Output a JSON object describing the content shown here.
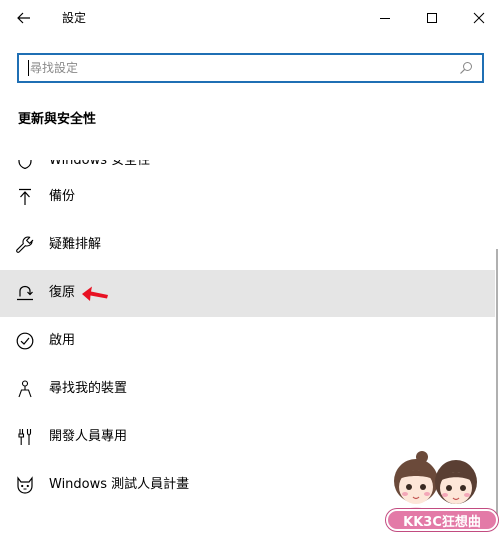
{
  "window": {
    "title": "設定"
  },
  "search": {
    "placeholder": "尋找設定"
  },
  "section": {
    "header": "更新與安全性"
  },
  "nav": {
    "items": [
      {
        "label": "Windows 安全性",
        "icon": "shield-icon"
      },
      {
        "label": "備份",
        "icon": "backup-arrow-icon"
      },
      {
        "label": "疑難排解",
        "icon": "wrench-icon"
      },
      {
        "label": "復原",
        "icon": "recovery-icon",
        "selected": true
      },
      {
        "label": "啟用",
        "icon": "checkmark-circle-icon"
      },
      {
        "label": "尋找我的裝置",
        "icon": "person-pin-icon"
      },
      {
        "label": "開發人員專用",
        "icon": "developer-tools-icon"
      },
      {
        "label": "Windows 測試人員計畫",
        "icon": "insider-cat-icon"
      }
    ]
  },
  "watermark": {
    "text": "KK3C狂想曲"
  },
  "colors": {
    "accent": "#1f6fb4",
    "selected_bg": "#e5e5e5",
    "arrow": "#e81123",
    "watermark_pink": "#e37aa7"
  }
}
